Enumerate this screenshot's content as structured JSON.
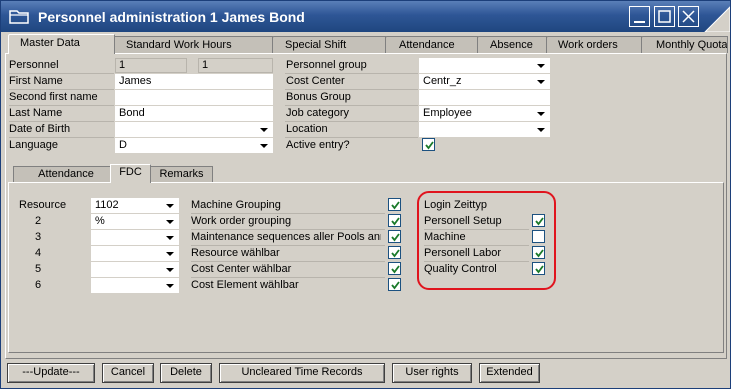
{
  "window": {
    "title": "Personnel administration 1 James Bond"
  },
  "tabs": [
    "Master Data",
    "Standard Work Hours",
    "Special Shift",
    "Attendance",
    "Absence",
    "Work orders",
    "Monthly Quota"
  ],
  "master": {
    "personnel_label": "Personnel",
    "personnel_value1": "1",
    "personnel_value2": "1",
    "first_name_label": "First Name",
    "first_name_value": "James",
    "second_first_name_label": "Second first name",
    "second_first_name_value": "",
    "last_name_label": "Last Name",
    "last_name_value": "Bond",
    "dob_label": "Date of Birth",
    "dob_value": "",
    "language_label": "Language",
    "language_value": "D",
    "personnel_group_label": "Personnel group",
    "personnel_group_value": "",
    "cost_center_label": "Cost Center",
    "cost_center_value": "Centr_z",
    "bonus_group_label": "Bonus Group",
    "bonus_group_value": "",
    "job_category_label": "Job category",
    "job_category_value": "Employee",
    "location_label": "Location",
    "location_value": "",
    "active_entry_label": "Active entry?",
    "active_entry_checked": true
  },
  "inner_tabs": [
    "Attendance",
    "FDC",
    "Remarks"
  ],
  "fdc": {
    "resource_label": "Resource",
    "rows": [
      {
        "label": "Resource",
        "value": "1102"
      },
      {
        "label": "2",
        "value": "%"
      },
      {
        "label": "3",
        "value": ""
      },
      {
        "label": "4",
        "value": ""
      },
      {
        "label": "5",
        "value": ""
      },
      {
        "label": "6",
        "value": ""
      }
    ],
    "options": [
      {
        "label": "Machine Grouping",
        "checked": true
      },
      {
        "label": "Work order grouping",
        "checked": true
      },
      {
        "label": "Maintenance sequences aller Pools anr",
        "checked": true
      },
      {
        "label": "Resource wählbar",
        "checked": true
      },
      {
        "label": "Cost Center wählbar",
        "checked": true
      },
      {
        "label": "Cost Element wählbar",
        "checked": true
      }
    ],
    "login_title": "Login Zeittyp",
    "login_options": [
      {
        "label": "Personell Setup",
        "checked": true
      },
      {
        "label": "Machine",
        "checked": false
      },
      {
        "label": "Personell Labor",
        "checked": true
      },
      {
        "label": "Quality Control",
        "checked": true
      }
    ]
  },
  "buttons": {
    "update": "---Update---",
    "cancel": "Cancel",
    "delete": "Delete",
    "uncleared": "Uncleared Time Records",
    "user_rights": "User rights",
    "extended": "Extended"
  },
  "colors": {
    "titlebar": "#2e5696",
    "window_bg": "#d4d0c8",
    "highlight": "#e0141e",
    "check": "#1a7a2a"
  }
}
